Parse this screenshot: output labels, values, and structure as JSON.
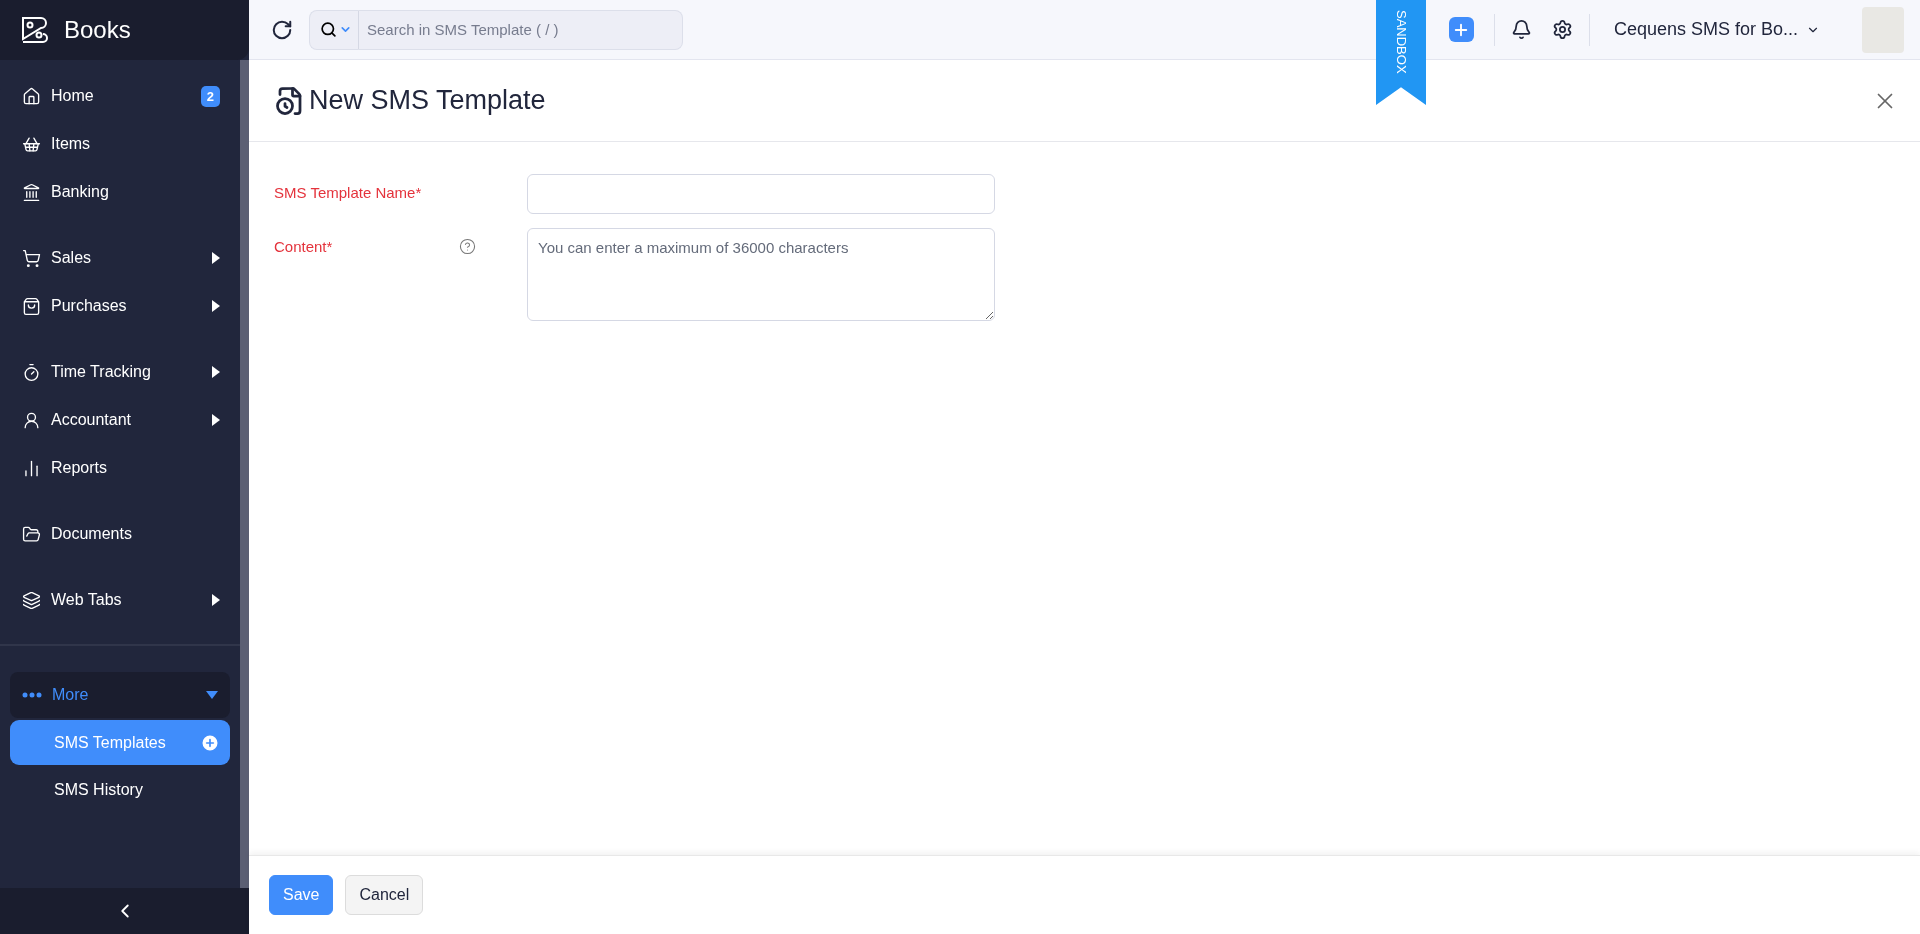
{
  "sidebar": {
    "brand": "Books",
    "groups": [
      [
        {
          "label": "Home",
          "badge": "2",
          "has_submenu": false
        },
        {
          "label": "Items",
          "has_submenu": false
        },
        {
          "label": "Banking",
          "has_submenu": false
        }
      ],
      [
        {
          "label": "Sales",
          "has_submenu": true
        },
        {
          "label": "Purchases",
          "has_submenu": true
        }
      ],
      [
        {
          "label": "Time Tracking",
          "has_submenu": true
        },
        {
          "label": "Accountant",
          "has_submenu": true
        },
        {
          "label": "Reports",
          "has_submenu": false
        }
      ],
      [
        {
          "label": "Documents",
          "has_submenu": false
        }
      ],
      [
        {
          "label": "Web Tabs",
          "has_submenu": true
        }
      ]
    ],
    "more": {
      "label": "More",
      "expanded": true,
      "children": [
        {
          "label": "SMS Templates",
          "selected": true
        },
        {
          "label": "SMS History",
          "selected": false
        }
      ]
    }
  },
  "topbar": {
    "search": {
      "placeholder": "Search in SMS Template ( / )"
    },
    "ribbon": "SANDBOX",
    "organization": "Cequens SMS for Bo..."
  },
  "page": {
    "title": "New SMS Template",
    "fields": [
      {
        "kind": "input",
        "label": "SMS Template Name*",
        "required": true,
        "help": false
      },
      {
        "kind": "textarea",
        "label": "Content*",
        "required": true,
        "help": true,
        "placeholder": "You can enter a maximum of 36000 characters"
      }
    ],
    "buttons": [
      {
        "label": "Save",
        "primary": true
      },
      {
        "label": "Cancel",
        "primary": false
      }
    ]
  }
}
